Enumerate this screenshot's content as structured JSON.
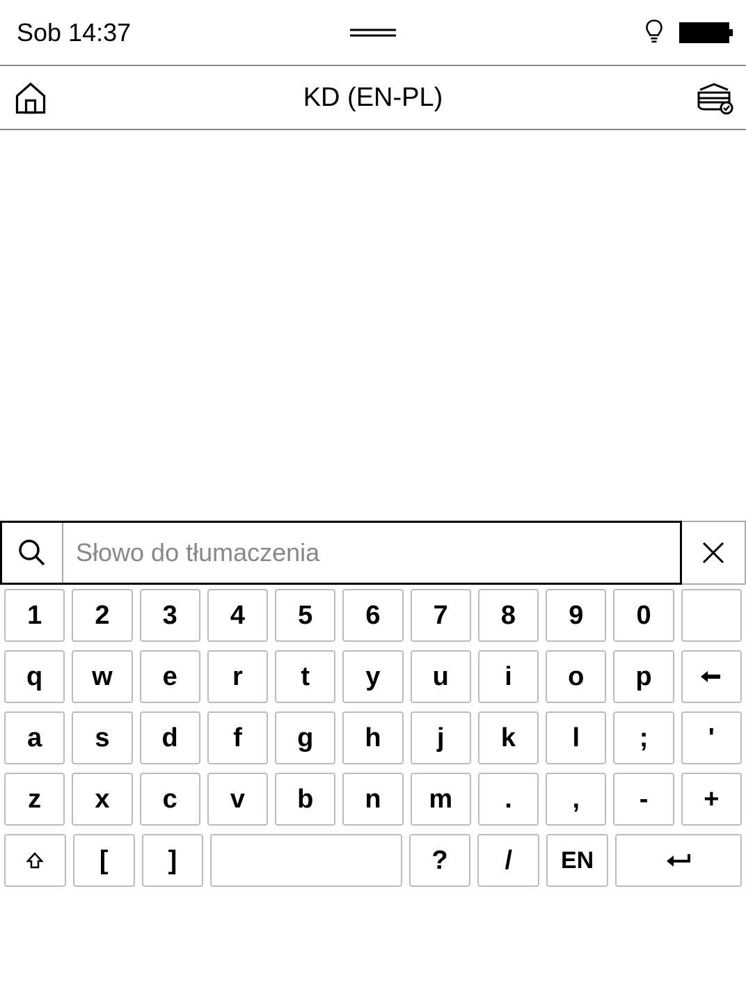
{
  "status": {
    "time": "Sob 14:37"
  },
  "header": {
    "title": "KD (EN-PL)"
  },
  "search": {
    "placeholder": "Słowo do tłumaczenia",
    "value": ""
  },
  "keyboard": {
    "row1": [
      "1",
      "2",
      "3",
      "4",
      "5",
      "6",
      "7",
      "8",
      "9",
      "0",
      ""
    ],
    "row2": [
      "q",
      "w",
      "e",
      "r",
      "t",
      "y",
      "u",
      "i",
      "o",
      "p",
      "←"
    ],
    "row3": [
      "a",
      "s",
      "d",
      "f",
      "g",
      "h",
      "j",
      "k",
      "l",
      ";",
      "'"
    ],
    "row4": [
      "z",
      "x",
      "c",
      "v",
      "b",
      "n",
      "m",
      ".",
      ",",
      "-",
      "+"
    ],
    "row5": {
      "shift": "⇧",
      "lbracket": "[",
      "rbracket": "]",
      "space": "",
      "question": "?",
      "slash": "/",
      "lang": "EN",
      "enter": "↵"
    }
  }
}
